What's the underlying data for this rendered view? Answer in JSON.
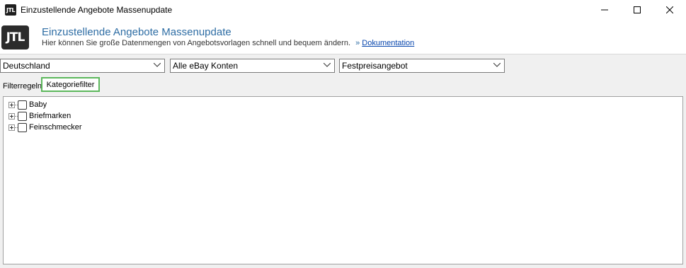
{
  "window": {
    "title": "Einzustellende Angebote Massenupdate",
    "icon_text": "JTL"
  },
  "header": {
    "logo_text": "JTL",
    "title": "Einzustellende Angebote Massenupdate",
    "subtitle": "Hier können Sie große Datenmengen von Angebotsvorlagen schnell und bequem ändern.",
    "link_arrow": "»",
    "link_label": "Dokumentation"
  },
  "filters": {
    "country": "Deutschland",
    "account": "Alle eBay Konten",
    "listing_type": "Festpreisangebot"
  },
  "tabs": [
    {
      "label": "Filterregeln"
    },
    {
      "label": "Kategoriefilter"
    }
  ],
  "tree": {
    "items": [
      {
        "label": "Baby",
        "checked": false
      },
      {
        "label": "Briefmarken",
        "checked": false
      },
      {
        "label": "Feinschmecker",
        "checked": false
      }
    ]
  },
  "colors": {
    "header_title": "#2e6da4",
    "active_tab_border": "#5cb85c",
    "link": "#0645ad"
  }
}
